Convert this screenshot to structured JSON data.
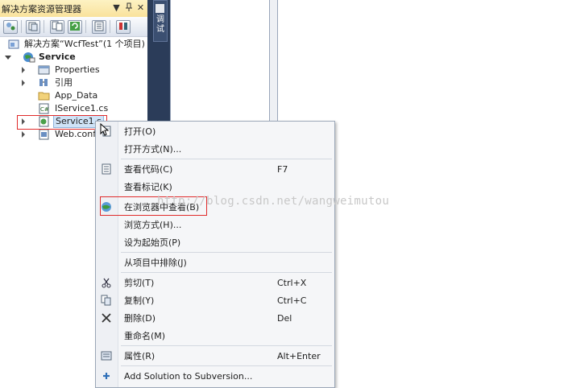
{
  "explorer": {
    "title": "解决方案资源管理器",
    "pin_glyph": "▼",
    "dock_glyph": "ф",
    "close_glyph": "✕",
    "tree": [
      {
        "label": "解决方案“WcfTest”(1 个项目)",
        "icon": "solution-icon"
      },
      {
        "label": "Service",
        "icon": "web-project-icon",
        "expanded": true
      },
      {
        "label": "Properties",
        "icon": "properties-icon",
        "collapsed": true
      },
      {
        "label": "引用",
        "icon": "references-icon",
        "collapsed": true
      },
      {
        "label": "App_Data",
        "icon": "folder-icon"
      },
      {
        "label": "IService1.cs",
        "icon": "csharp-file-icon"
      },
      {
        "label": "Service1.s",
        "icon": "svc-file-icon",
        "collapsed": true,
        "selected": true
      },
      {
        "label": "Web.conf",
        "icon": "config-file-icon",
        "collapsed": true
      }
    ]
  },
  "side_tab": {
    "label": "调试"
  },
  "watermark": "http://blog.csdn.net/wangweimutou",
  "context_menu": {
    "items": [
      {
        "label": "打开(O)",
        "key": "",
        "icon": "open-file-icon"
      },
      {
        "label": "打开方式(N)...",
        "key": ""
      },
      {
        "label": "查看代码(C)",
        "key": "F7",
        "icon": "view-code-icon"
      },
      {
        "label": "查看标记(K)",
        "key": ""
      },
      {
        "label": "在浏览器中查看(B)",
        "key": "",
        "icon": "browser-icon",
        "highlighted": true
      },
      {
        "label": "浏览方式(H)...",
        "key": ""
      },
      {
        "label": "设为起始页(P)",
        "key": ""
      },
      {
        "label": "从项目中排除(J)",
        "key": ""
      },
      {
        "label": "剪切(T)",
        "key": "Ctrl+X",
        "icon": "scissors-icon"
      },
      {
        "label": "复制(Y)",
        "key": "Ctrl+C",
        "icon": "copy-icon"
      },
      {
        "label": "删除(D)",
        "key": "Del",
        "icon": "delete-icon"
      },
      {
        "label": "重命名(M)",
        "key": ""
      },
      {
        "label": "属性(R)",
        "key": "Alt+Enter",
        "icon": "properties-icon"
      },
      {
        "label": "Add Solution to Subversion...",
        "key": "",
        "icon": "subversion-icon"
      }
    ]
  },
  "colors": {
    "accent_red": "#e02b2b",
    "panel_title": "#f9e29c",
    "dark_strip": "#2b3c59"
  }
}
